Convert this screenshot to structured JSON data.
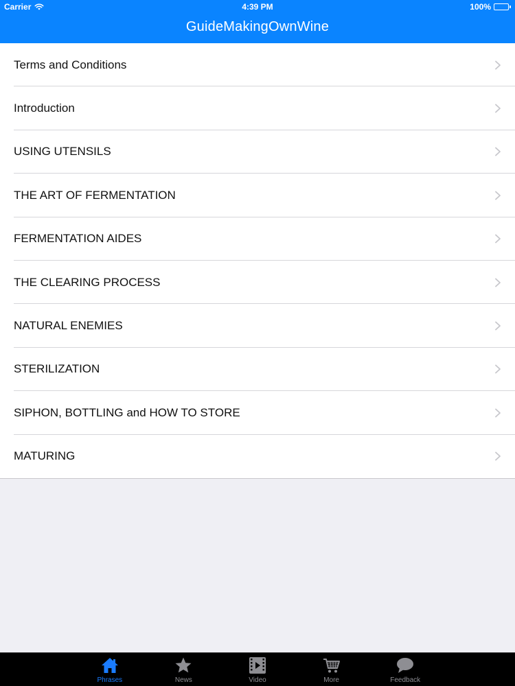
{
  "status_bar": {
    "carrier": "Carrier",
    "time": "4:39 PM",
    "battery": "100%",
    "battery_level": 1.0
  },
  "nav": {
    "title": "GuideMakingOwnWine"
  },
  "list": {
    "items": [
      {
        "label": "Terms and Conditions"
      },
      {
        "label": "Introduction"
      },
      {
        "label": "USING UTENSILS"
      },
      {
        "label": "THE ART OF FERMENTATION"
      },
      {
        "label": "FERMENTATION AIDES"
      },
      {
        "label": "THE CLEARING PROCESS"
      },
      {
        "label": "NATURAL ENEMIES"
      },
      {
        "label": "STERILIZATION"
      },
      {
        "label": "SIPHON, BOTTLING and HOW TO STORE"
      },
      {
        "label": "MATURING"
      }
    ]
  },
  "tab_bar": {
    "tabs": [
      {
        "label": "Phrases",
        "icon": "home-icon",
        "active": true
      },
      {
        "label": "News",
        "icon": "star-icon",
        "active": false
      },
      {
        "label": "Video",
        "icon": "film-icon",
        "active": false
      },
      {
        "label": "More",
        "icon": "cart-icon",
        "active": false
      },
      {
        "label": "Feedback",
        "icon": "chat-bubble-icon",
        "active": false
      }
    ]
  },
  "colors": {
    "accent": "#0a84ff",
    "tab_active": "#1a7cff",
    "tab_inactive": "#8e8e93",
    "background": "#efeff4"
  }
}
